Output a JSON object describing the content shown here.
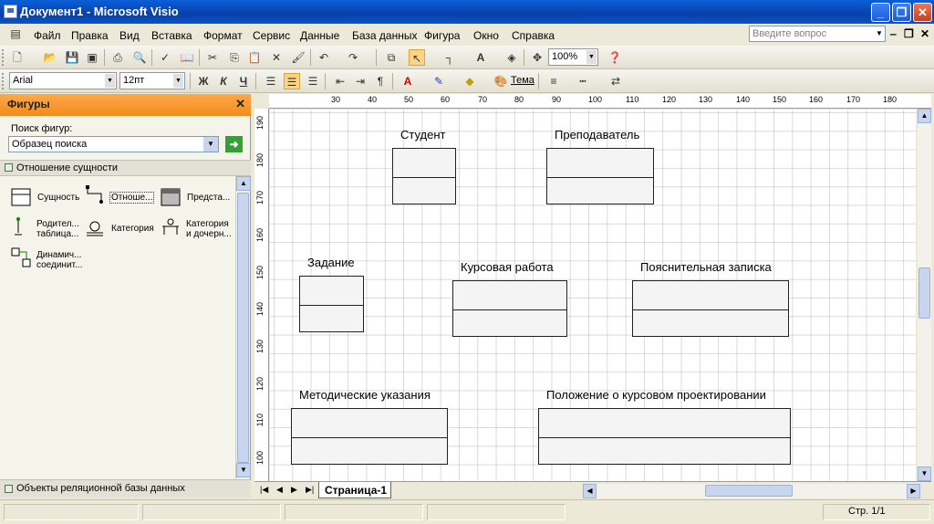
{
  "window": {
    "title": "Документ1 - Microsoft Visio"
  },
  "menu": {
    "items": [
      "Файл",
      "Правка",
      "Вид",
      "Вставка",
      "Формат",
      "Сервис",
      "Данные",
      "База данных",
      "Фигура",
      "Окно",
      "Справка"
    ],
    "help_placeholder": "Введите вопрос"
  },
  "toolbar": {
    "zoom": "100%"
  },
  "format_toolbar": {
    "font": "Arial",
    "size": "12пт",
    "bold": "Ж",
    "italic": "К",
    "underline": "Ч",
    "theme": "Тема"
  },
  "shapes_panel": {
    "title": "Фигуры",
    "search_label": "Поиск фигур:",
    "search_value": "Образец поиска",
    "stencil_name": "Отношение сущности",
    "shapes": [
      {
        "label1": "Сущность",
        "label2": ""
      },
      {
        "label1": "Отноше...",
        "label2": ""
      },
      {
        "label1": "Предста...",
        "label2": ""
      },
      {
        "label1": "Родител...",
        "label2": "таблица..."
      },
      {
        "label1": "Категория",
        "label2": ""
      },
      {
        "label1": "Категория",
        "label2": "и дочерн..."
      },
      {
        "label1": "Динамич...",
        "label2": "соединит..."
      }
    ],
    "stencil2_name": "Объекты реляционной базы данных"
  },
  "rulers": {
    "top": [
      "30",
      "40",
      "50",
      "60",
      "70",
      "80",
      "90",
      "100",
      "110",
      "120",
      "130",
      "140",
      "150",
      "160",
      "170",
      "180"
    ],
    "left": [
      "190",
      "180",
      "170",
      "160",
      "150",
      "140",
      "130",
      "120",
      "110",
      "100"
    ]
  },
  "diagram": {
    "entities": [
      {
        "name": "Студент"
      },
      {
        "name": "Преподаватель"
      },
      {
        "name": "Задание"
      },
      {
        "name": "Курсовая работа"
      },
      {
        "name": "Пояснительная записка"
      },
      {
        "name": "Методические указания"
      },
      {
        "name": "Положение о курсовом проектировании"
      }
    ]
  },
  "tabs": {
    "page": "Страница-1"
  },
  "status": {
    "page": "Стр. 1/1"
  }
}
